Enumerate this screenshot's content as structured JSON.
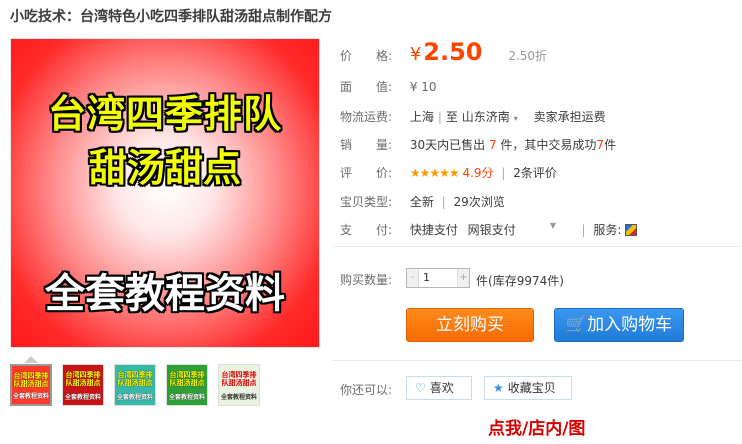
{
  "page_title": "小吃技术：台湾特色小吃四季排队甜汤甜点制作配方",
  "hero": {
    "line1": "台湾四季排队",
    "line2": "甜汤甜点",
    "line3": "全套教程资料"
  },
  "thumbnails": [
    {
      "top": "台湾四季排队甜汤甜点",
      "bottom": "全套教程资料",
      "bg": "#ff3a2a"
    },
    {
      "top": "台湾四季排队甜汤甜点",
      "bottom": "全套教程资料",
      "bg": "#c81414"
    },
    {
      "top": "台湾四季排队甜汤甜点",
      "bottom": "全套教程资料",
      "bg": "#37b8a8"
    },
    {
      "top": "台湾四季排队甜汤甜点",
      "bottom": "全套教程资料",
      "bg": "#2f9f38"
    },
    {
      "top": "台湾四季排队甜汤甜点",
      "bottom": "全套教程资料",
      "bg": "#e8f4e0"
    }
  ],
  "price": {
    "label": "价　　格:",
    "symbol": "¥",
    "value": "2.50",
    "discount": "2.50折"
  },
  "face_value": {
    "label": "面　　值:",
    "value": "¥ 10"
  },
  "shipping": {
    "label": "物流运费:",
    "from": "上海",
    "to_prefix": "至",
    "to": "山东济南",
    "note": "卖家承担运费"
  },
  "sales": {
    "label": "销　　量:",
    "prefix": "30天内已售出",
    "count": "7",
    "mid": "件，其中交易成功",
    "success": "7",
    "suffix": "件"
  },
  "rating": {
    "label": "评　　价:",
    "stars": "★★★★★",
    "score": "4.9分",
    "reviews": "2条评价"
  },
  "item_type": {
    "label": "宝贝类型:",
    "type": "全新",
    "views": "29次浏览"
  },
  "payment": {
    "label": "支　　付:",
    "method1": "快捷支付",
    "method2": "网银支付",
    "service_label": "服务:"
  },
  "quantity": {
    "label": "购买数量:",
    "value": "1",
    "unit": "件",
    "stock": "(库存9974件)",
    "minus": "-",
    "plus": "+"
  },
  "buttons": {
    "buy_now": "立刻购买",
    "add_cart": "加入购物车",
    "cart_icon": "🛒"
  },
  "also": {
    "label": "你还可以:",
    "like": "喜欢",
    "favorite": "收藏宝贝",
    "like_icon": "heart-icon",
    "fav_icon": "star-icon"
  },
  "bottom_text": "点我/店内/图",
  "colors": {
    "price": "#ff4400",
    "buy": "#f76b00",
    "cart": "#1f7ad8",
    "hero_text": "#f2ff00"
  }
}
